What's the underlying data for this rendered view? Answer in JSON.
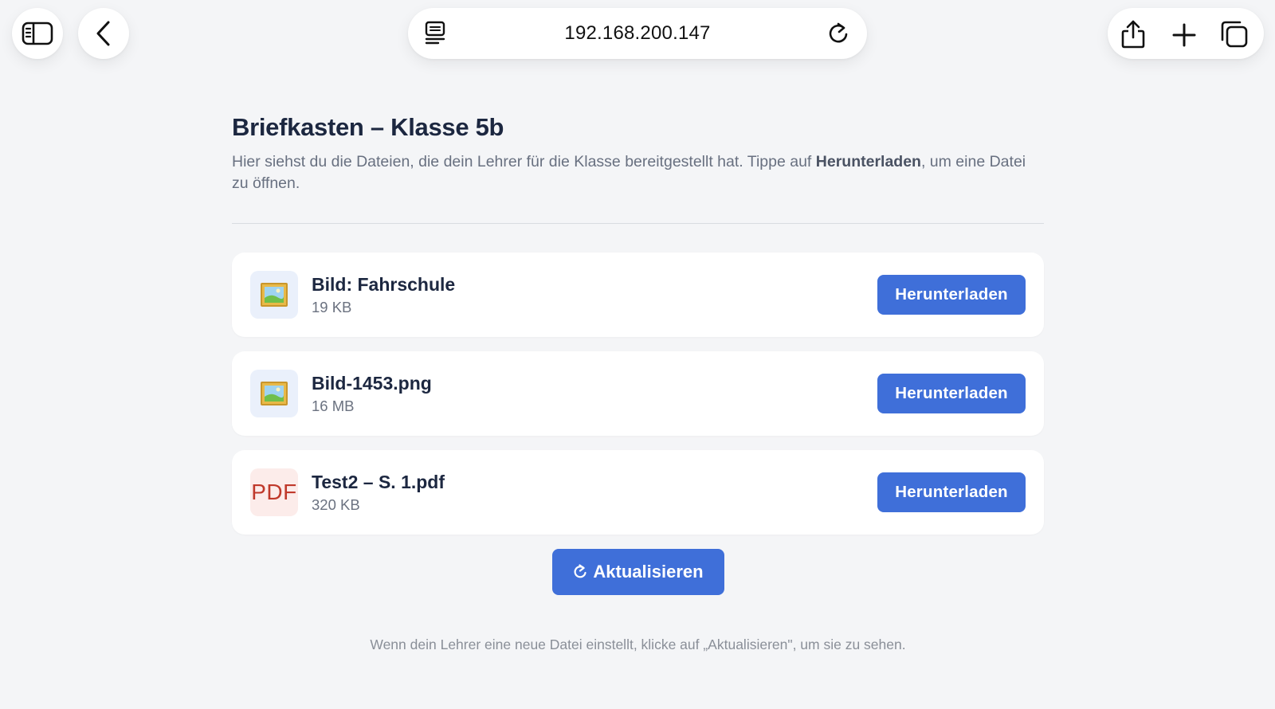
{
  "browser": {
    "url": "192.168.200.147"
  },
  "page": {
    "title": "Briefkasten – Klasse 5b",
    "intro_before": "Hier siehst du die Dateien, die dein Lehrer für die Klasse bereitgestellt hat. Tippe auf ",
    "intro_bold": "Herunterladen",
    "intro_after": ", um eine Datei zu öffnen.",
    "files": [
      {
        "name": "Bild: Fahrschule",
        "size": "19 KB",
        "icon": "framed-picture-icon",
        "button": "Herunterladen"
      },
      {
        "name": "Bild-1453.png",
        "size": "16 MB",
        "icon": "framed-picture-icon",
        "button": "Herunterladen"
      },
      {
        "name": "Test2 – S. 1.pdf",
        "size": "320 KB",
        "icon": "pdf-icon",
        "icon_text": "PDF",
        "button": "Herunterladen"
      }
    ],
    "refresh_label": "Aktualisieren",
    "hint": "Wenn dein Lehrer eine neue Datei einstellt, klicke auf „Aktualisieren\", um sie zu sehen."
  },
  "colors": {
    "accent": "#3f6fd9",
    "background": "#f4f5f7",
    "title": "#1c2740"
  }
}
